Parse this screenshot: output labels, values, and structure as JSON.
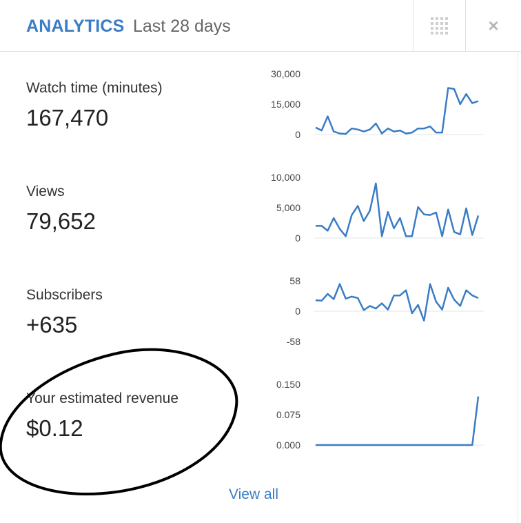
{
  "header": {
    "title": "ANALYTICS",
    "period": "Last 28 days",
    "title_color": "#3a7cc5",
    "grid_icon": "grid-icon",
    "close_icon": "close-icon",
    "close_glyph": "×"
  },
  "metrics": [
    {
      "label": "Watch time (minutes)",
      "value": "167,470"
    },
    {
      "label": "Views",
      "value": "79,652"
    },
    {
      "label": "Subscribers",
      "value": "+635"
    },
    {
      "label": "Your estimated revenue",
      "value": "$0.12"
    }
  ],
  "view_all": "View all",
  "line_color": "#3a7cc5",
  "annotation": {
    "shape": "hand-drawn ellipse",
    "color": "#000000"
  },
  "chart_data": [
    {
      "type": "line",
      "title": "Watch time (minutes)",
      "ylim": [
        0,
        30000
      ],
      "y_ticks": [
        "30,000",
        "15,000",
        "0"
      ],
      "y_tick_values": [
        30000,
        15000,
        0
      ],
      "values": [
        3500,
        2000,
        9000,
        1500,
        500,
        300,
        3000,
        2500,
        1500,
        2500,
        5500,
        500,
        3000,
        1500,
        2000,
        500,
        1000,
        3000,
        3000,
        4000,
        1000,
        1000,
        23000,
        22500,
        15000,
        20000,
        15500,
        16500
      ]
    },
    {
      "type": "line",
      "title": "Views",
      "ylim": [
        0,
        10000
      ],
      "y_ticks": [
        "10,000",
        "5,000",
        "0"
      ],
      "y_tick_values": [
        10000,
        5000,
        0
      ],
      "values": [
        2000,
        2000,
        1200,
        3300,
        1500,
        300,
        3800,
        5300,
        2800,
        4500,
        9000,
        300,
        4300,
        1600,
        3300,
        300,
        300,
        5100,
        3900,
        3800,
        4200,
        300,
        4700,
        1000,
        600,
        4900,
        500,
        3700
      ]
    },
    {
      "type": "line",
      "title": "Subscribers",
      "ylim": [
        -58,
        58
      ],
      "y_ticks": [
        "58",
        "0",
        "-58"
      ],
      "y_tick_values": [
        58,
        0,
        -58
      ],
      "values": [
        21,
        20,
        33,
        23,
        52,
        24,
        28,
        25,
        2,
        10,
        5,
        15,
        3,
        30,
        30,
        40,
        -4,
        12,
        -18,
        52,
        18,
        3,
        45,
        22,
        10,
        40,
        30,
        25
      ]
    },
    {
      "type": "line",
      "title": "Your estimated revenue",
      "ylim": [
        0,
        0.15
      ],
      "y_ticks": [
        "0.150",
        "0.075",
        "0.000"
      ],
      "y_tick_values": [
        0.15,
        0.075,
        0
      ],
      "values": [
        0,
        0,
        0,
        0,
        0,
        0,
        0,
        0,
        0,
        0,
        0,
        0,
        0,
        0,
        0,
        0,
        0,
        0,
        0,
        0,
        0,
        0,
        0,
        0,
        0,
        0,
        0,
        0.12
      ]
    }
  ]
}
